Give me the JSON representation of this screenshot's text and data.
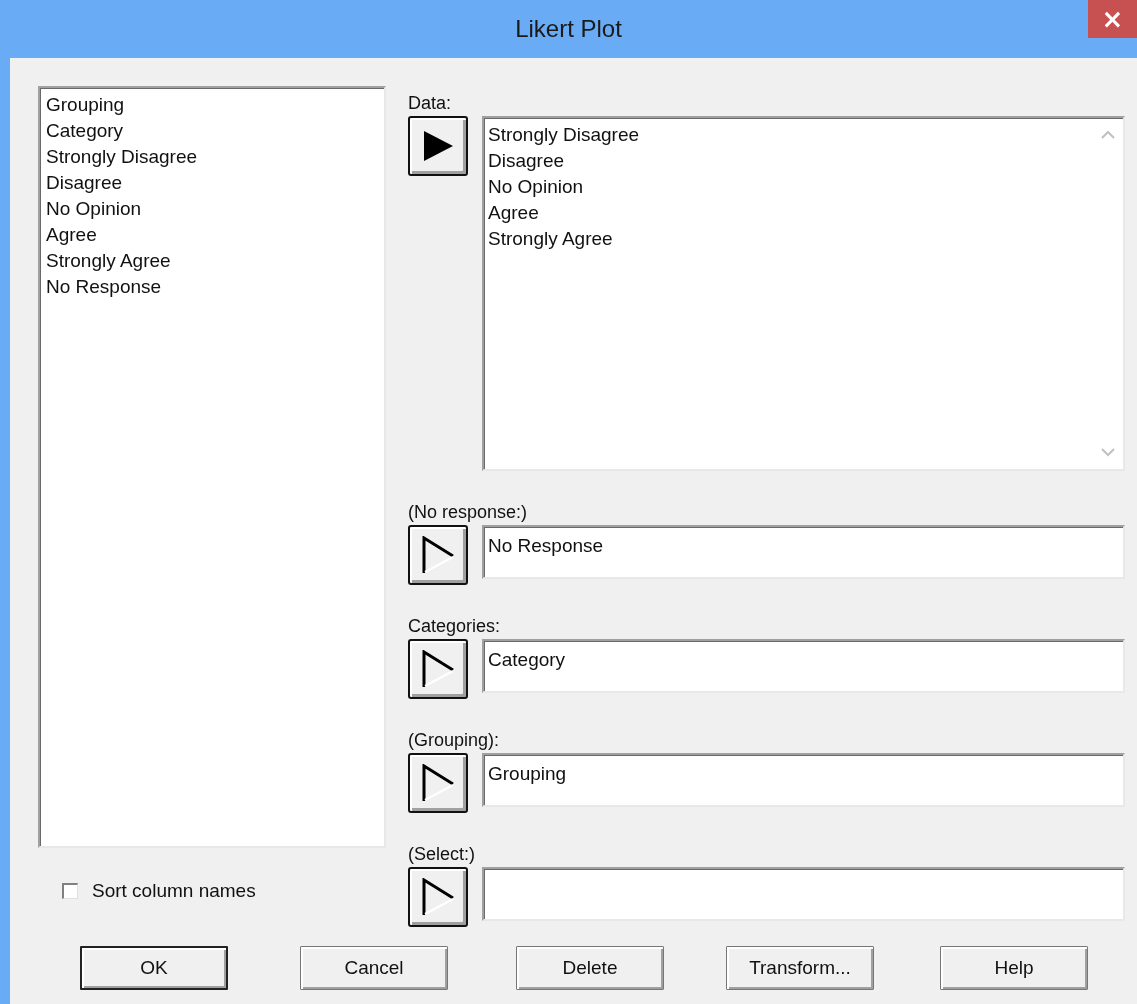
{
  "window": {
    "title": "Likert Plot",
    "close": "×"
  },
  "columns_list": {
    "items": [
      "Grouping",
      "Category",
      "Strongly Disagree",
      "Disagree",
      "No Opinion",
      "Agree",
      "Strongly Agree",
      "No Response"
    ]
  },
  "sort_column_names": {
    "label": "Sort column names",
    "checked": false
  },
  "fields": [
    {
      "kind": "list",
      "label": "Data:",
      "arrow_enabled": true,
      "items": [
        "Strongly Disagree",
        "Disagree",
        "No Opinion",
        "Agree",
        "Strongly Agree"
      ]
    },
    {
      "kind": "text",
      "label": "(No response:)",
      "arrow_enabled": false,
      "value": "No Response"
    },
    {
      "kind": "text",
      "label": "Categories:",
      "arrow_enabled": false,
      "value": "Category"
    },
    {
      "kind": "text",
      "label": "(Grouping):",
      "arrow_enabled": false,
      "value": "Grouping"
    },
    {
      "kind": "text",
      "label": "(Select:)",
      "arrow_enabled": false
    }
  ],
  "buttons": [
    {
      "label": "OK",
      "default": true
    },
    {
      "label": "Cancel",
      "default": false
    },
    {
      "label": "Delete",
      "default": false
    },
    {
      "label": "Transform...",
      "default": false
    },
    {
      "label": "Help",
      "default": false
    }
  ]
}
